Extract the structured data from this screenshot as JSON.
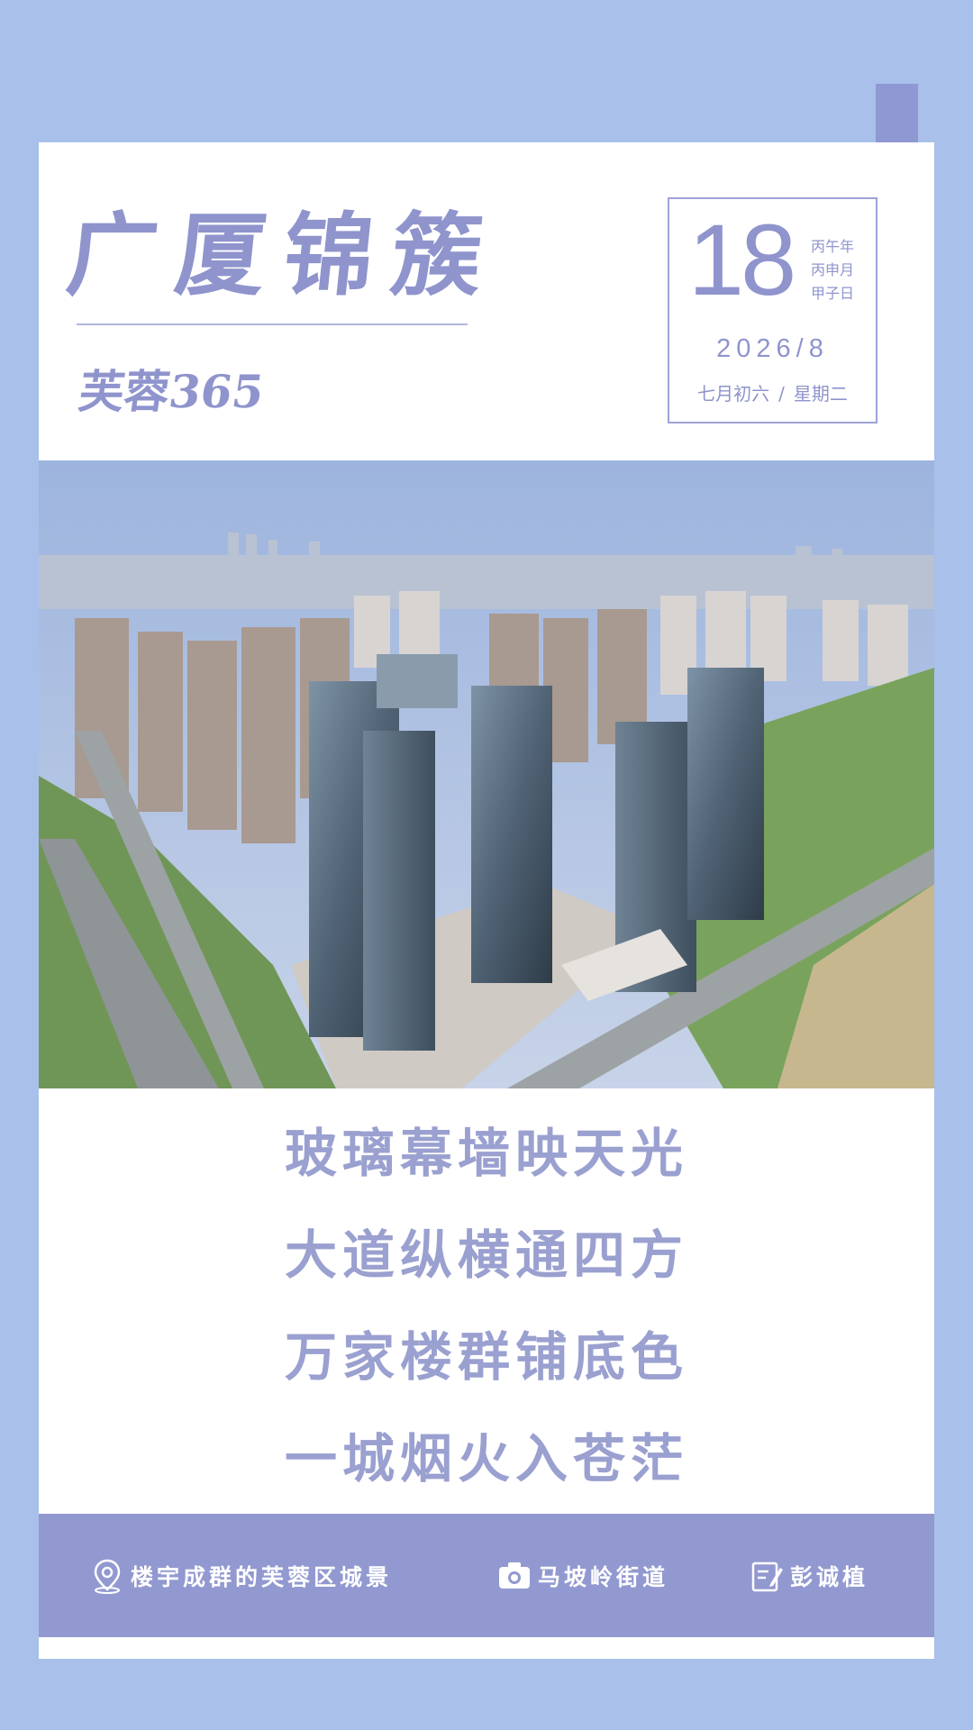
{
  "header": {
    "title": "广厦锦簇",
    "subtitle": "芙蓉365"
  },
  "date": {
    "day": "18",
    "ganzhi": [
      "丙午年",
      "丙申月",
      "甲子日"
    ],
    "year_month": "2026/8",
    "lunar": "七月初六",
    "separator": "/",
    "weekday": "星期二"
  },
  "photo": {
    "description_icon": "aerial-city-photo"
  },
  "poem": [
    "玻璃幕墙映天光",
    "大道纵横通四方",
    "万家楼群铺底色",
    "一城烟火入苍茫"
  ],
  "footer": {
    "location_icon": "location-pin-icon",
    "location": "楼宇成群的芙蓉区城景",
    "camera_icon": "camera-icon",
    "place": "马坡岭街道",
    "author_icon": "edit-icon",
    "author": "彭诚植"
  },
  "colors": {
    "background": "#a9c0ea",
    "accent": "#8f98d2",
    "text": "#8f94cd",
    "footer": "#9299d0"
  }
}
